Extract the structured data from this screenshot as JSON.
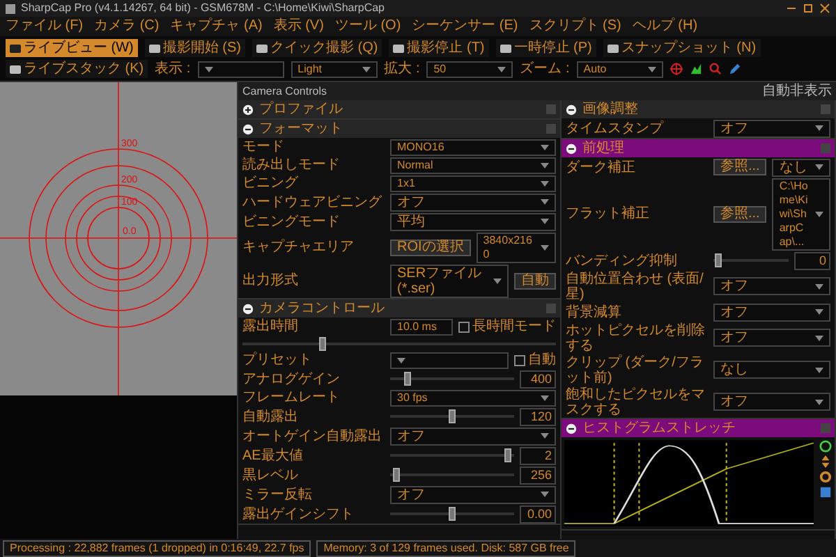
{
  "window": {
    "title": "SharpCap Pro (v4.1.14267, 64 bit) - GSM678M - C:\\Home\\Kiwi\\SharpCap"
  },
  "menu": [
    "ファイル (F)",
    "カメラ (C)",
    "キャプチャ (A)",
    "表示 (V)",
    "ツール (O)",
    "シーケンサー (E)",
    "スクリプト (S)",
    "ヘルプ (H)"
  ],
  "toolbar": [
    {
      "kind": "button",
      "label": "ライブビュー (W)",
      "selected": true
    },
    {
      "kind": "button",
      "label": "撮影開始 (S)",
      "selected": false
    },
    {
      "kind": "button",
      "label": "クイック撮影 (Q)",
      "selected": false
    },
    {
      "kind": "button",
      "label": "撮影停止 (T)",
      "selected": false
    },
    {
      "kind": "button",
      "label": "一時停止 (P)",
      "selected": false
    },
    {
      "kind": "button",
      "label": "スナップショット (N)",
      "selected": false
    },
    {
      "kind": "button",
      "label": "ライブスタック (K)",
      "selected": false
    },
    {
      "kind": "label",
      "label": "表示 :"
    },
    {
      "kind": "dropdown"
    },
    {
      "kind": "dropdown",
      "value": "Light"
    },
    {
      "kind": "label",
      "label": "拡大 :"
    },
    {
      "kind": "dropdown",
      "value": "50"
    },
    {
      "kind": "label",
      "label": "ズーム :"
    },
    {
      "kind": "dropdown",
      "value": "Auto"
    }
  ],
  "viewer": {
    "center_label": "0.0",
    "ring_labels": [
      "300",
      "200",
      "100"
    ]
  },
  "panel": {
    "title": "Camera Controls",
    "pin_label": "自動非表示",
    "columns": [
      [
        {
          "title": "プロファイル",
          "expanded": false,
          "highlighted": false
        },
        {
          "title": "フォーマット",
          "expanded": true,
          "highlighted": false,
          "rows": [
            {
              "kind": "dropdown",
              "label": "モード",
              "value": "MONO16"
            },
            {
              "kind": "dropdown",
              "label": "読み出しモード",
              "value": "Normal"
            },
            {
              "kind": "dropdown",
              "label": "ビニング",
              "value": "1x1"
            },
            {
              "kind": "dropdown",
              "label": "ハードウェアビニング",
              "value": "オフ"
            },
            {
              "kind": "dropdown",
              "label": "ビニングモード",
              "value": "平均"
            },
            {
              "kind": "button_dropdown",
              "label": "キャプチャエリア",
              "button": "ROIの選択",
              "value": "3840x2160"
            },
            {
              "kind": "dropdown_button",
              "label": "出力形式",
              "value": "SERファイル (*.ser)",
              "button": "自動"
            }
          ]
        },
        {
          "title": "カメラコントロール",
          "expanded": true,
          "highlighted": false,
          "rows": [
            {
              "kind": "field_check",
              "label": "露出時間",
              "value": "10.0 ms",
              "check_label": "長時間モード",
              "checked": false
            },
            {
              "kind": "slider",
              "level": 0.25
            },
            {
              "kind": "dropdown_check",
              "label": "プリセット",
              "check_label": "自動",
              "checked": false
            },
            {
              "kind": "slider",
              "label": "アナログゲイン",
              "level": 0.12,
              "reading": "400"
            },
            {
              "kind": "dropdown",
              "label": "フレームレート",
              "value": "30 fps"
            },
            {
              "kind": "slider",
              "label": "自動露出",
              "level": 0.5,
              "reading": "120"
            },
            {
              "kind": "dropdown",
              "label": "オートゲイン自動露出",
              "value": "オフ"
            },
            {
              "kind": "slider",
              "label": "AE最大値",
              "level": 0.98,
              "reading": "2"
            },
            {
              "kind": "slider",
              "label": "黒レベル",
              "level": 0.02,
              "reading": "256"
            },
            {
              "kind": "dropdown",
              "label": "ミラー反転",
              "value": "オフ"
            },
            {
              "kind": "slider",
              "label": "露出ゲインシフト",
              "level": 0.5,
              "reading": "0.00"
            }
          ]
        }
      ],
      [
        {
          "title": "画像調整",
          "expanded": true,
          "highlighted": false,
          "rows": [
            {
              "kind": "dropdown",
              "label": "タイムスタンプ",
              "value": "オフ"
            }
          ]
        },
        {
          "title": "前処理",
          "expanded": true,
          "highlighted": true,
          "rows": [
            {
              "kind": "button_dropdown",
              "label": "ダーク補正",
              "button": "参照...",
              "value": "なし"
            },
            {
              "kind": "button_dropdown",
              "label": "フラット補正",
              "button": "参照...",
              "value": "C:\\Home\\Kiwi\\SharpCap\\..."
            },
            {
              "kind": "slider",
              "label": "バンディング抑制",
              "level": 0.02,
              "reading": "0"
            },
            {
              "kind": "dropdown",
              "label": "自動位置合わせ (表面/星)",
              "value": "オフ"
            },
            {
              "kind": "dropdown",
              "label": "背景減算",
              "value": "オフ"
            },
            {
              "kind": "dropdown",
              "label": "ホットピクセルを削除する",
              "value": "オフ"
            },
            {
              "kind": "dropdown",
              "label": "クリップ (ダーク/フラット前)",
              "value": "なし"
            },
            {
              "kind": "dropdown",
              "label": "飽和したピクセルをマスクする",
              "value": "オフ"
            }
          ]
        },
        {
          "title": "ヒストグラムストレッチ",
          "expanded": true,
          "highlighted": true,
          "rows": [
            {
              "kind": "histogram"
            }
          ]
        }
      ]
    ]
  },
  "status_bar": [
    "Processing : 22,882 frames (1 dropped) in 0:16:49, 22.7 fps",
    "Memory: 3 of 129 frames used. Disk: 587 GB free"
  ]
}
